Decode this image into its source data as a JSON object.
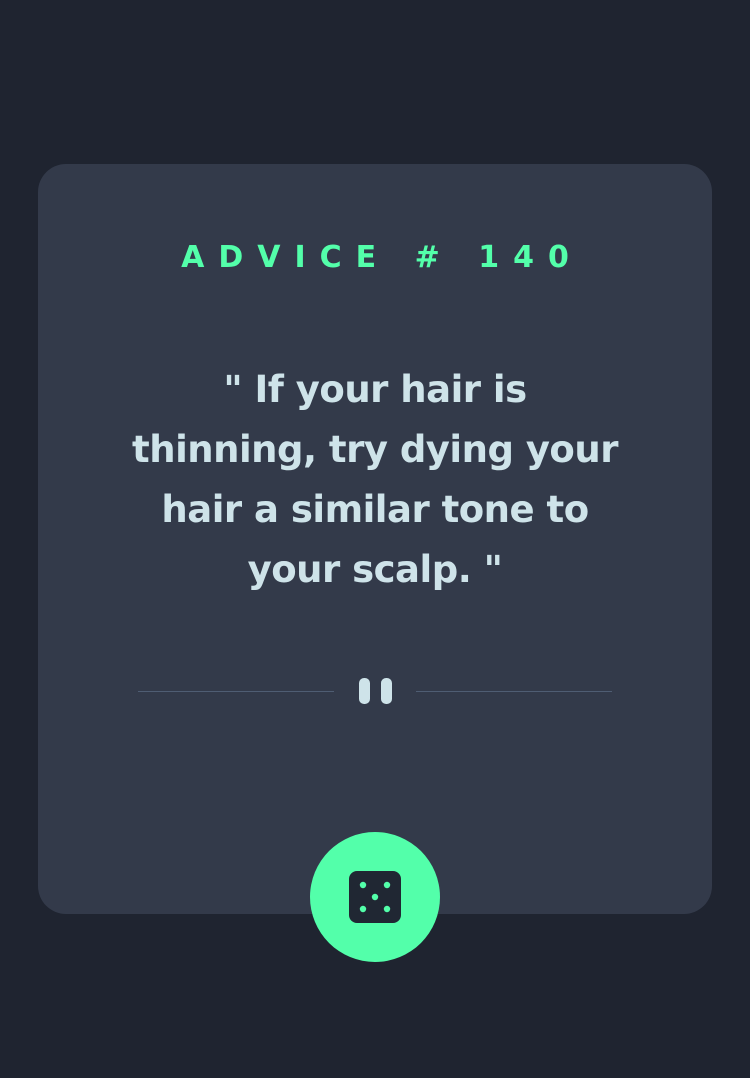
{
  "advice": {
    "id_label": "ADVICE # 140",
    "quote": "\" If your hair is thinning, try dying your hair a similar tone to your scalp. \""
  },
  "icons": {
    "divider": "pause-icon",
    "button": "dice-icon"
  },
  "colors": {
    "background": "#1f2430",
    "card": "#333a4a",
    "accent": "#53ffaa",
    "text": "#cee3e9",
    "divider_line": "#4f5d73"
  }
}
